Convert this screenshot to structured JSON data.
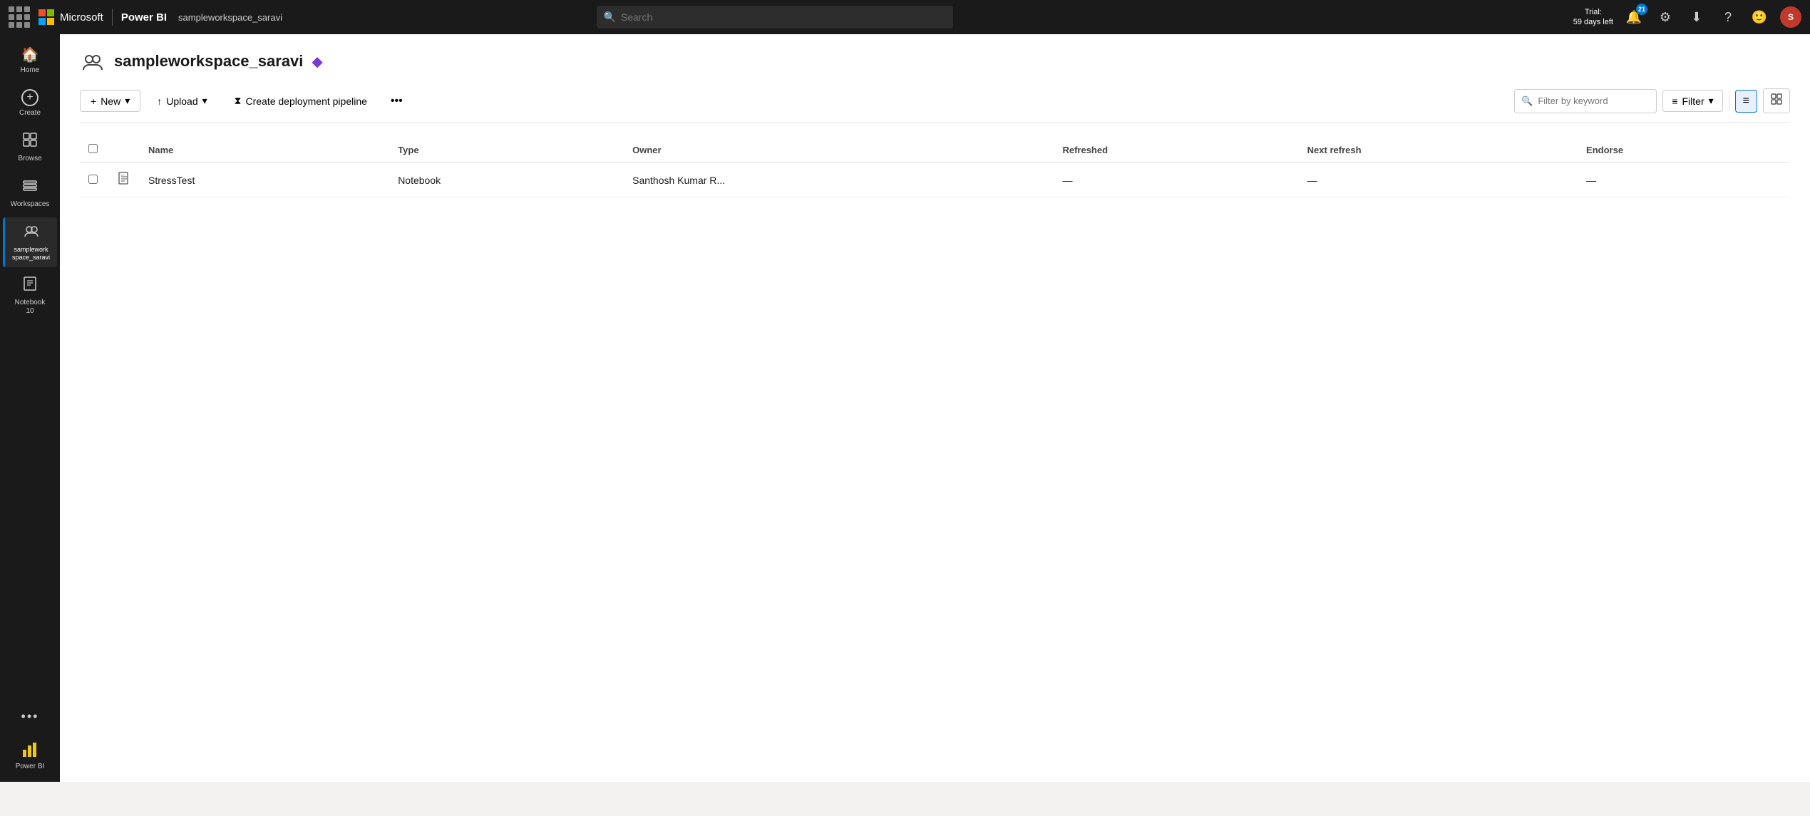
{
  "topbar": {
    "app_name": "Power BI",
    "workspace_name": "sampleworkspace_saravi",
    "search_placeholder": "Search",
    "trial_label": "Trial:",
    "trial_days": "59 days left",
    "notification_count": "21",
    "ms_logo_alt": "Microsoft"
  },
  "sidebar": {
    "items": [
      {
        "id": "home",
        "label": "Home",
        "icon": "⌂"
      },
      {
        "id": "create",
        "label": "Create",
        "icon": "+"
      },
      {
        "id": "browse",
        "label": "Browse",
        "icon": "⊞"
      },
      {
        "id": "workspaces",
        "label": "Workspaces",
        "icon": "🗄"
      },
      {
        "id": "sampleworkspace",
        "label": "samplework\nspace_saravi",
        "icon": "👥",
        "active": true
      },
      {
        "id": "notebook10",
        "label": "Notebook\n10",
        "icon": "</>"
      }
    ],
    "more_label": "•••",
    "powerbi_label": "Power BI"
  },
  "workspace": {
    "title": "sampleworkspace_saravi",
    "premium_icon": "◆"
  },
  "toolbar": {
    "new_label": "New",
    "upload_label": "Upload",
    "pipeline_label": "Create deployment pipeline",
    "more_label": "•••",
    "filter_placeholder": "Filter by keyword",
    "filter_btn_label": "Filter",
    "view_list_label": "≡",
    "view_grid_label": "⊞"
  },
  "table": {
    "columns": [
      {
        "id": "name",
        "label": "Name"
      },
      {
        "id": "type",
        "label": "Type"
      },
      {
        "id": "owner",
        "label": "Owner"
      },
      {
        "id": "refreshed",
        "label": "Refreshed"
      },
      {
        "id": "next_refresh",
        "label": "Next refresh"
      },
      {
        "id": "endorse",
        "label": "Endorse"
      }
    ],
    "rows": [
      {
        "name": "StressTest",
        "type": "Notebook",
        "owner": "Santhosh Kumar R...",
        "refreshed": "—",
        "next_refresh": "—",
        "endorse": "—"
      }
    ]
  }
}
